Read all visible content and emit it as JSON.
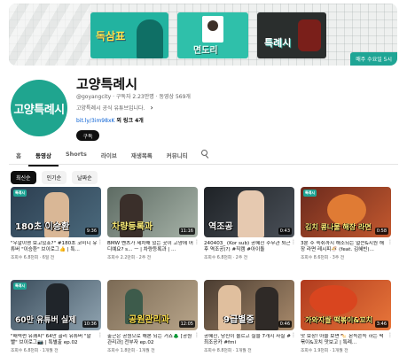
{
  "banner": {
    "card1_text": "독삼표",
    "card2_text": "면도리",
    "card3_text": "특례시",
    "tag": "매주 수요일 5시"
  },
  "channel": {
    "avatar_text": "고양특례시",
    "name": "고양특례시",
    "meta": "@goyangcity · 구독자 2.23만명 · 동영상 569개",
    "description": "고양특례시 공식 유튜브입니다.",
    "link_url": "bit.ly/3im98xK",
    "link_more": "외 링크 4개",
    "subscribe_label": "구독"
  },
  "tabs": [
    {
      "label": "홈"
    },
    {
      "label": "동영상"
    },
    {
      "label": "Shorts"
    },
    {
      "label": "라이브"
    },
    {
      "label": "재생목록"
    },
    {
      "label": "커뮤니티"
    }
  ],
  "chips": [
    {
      "label": "최신순"
    },
    {
      "label": "인기순"
    },
    {
      "label": "날짜순"
    }
  ],
  "videos": [
    {
      "thumb_text": "180초 이승환",
      "duration": "9:36",
      "title": "\"우알이영 보고있죠?\" #180초 코미디 유튜버 \"이승환\" 브이로그👍 | 특...",
      "meta": "조회수 6.8천회 · 6일 전"
    },
    {
      "thumb_text": "차량등록과",
      "duration": "11:16",
      "title": "BMW 벤츠가 세차해 있는 곳이 고양에 어디예요? s... ㅡ | 차량등록과 | ...",
      "meta": "조회수 2.2만회 · 2주 전"
    },
    {
      "thumb_text": "역조공",
      "duration": "0:43",
      "title": "240403_ (Kor sub) 공혜진 주무관 퇴근 후 역조공(?) #직캠 #아이돌",
      "meta": "조회수 6.8천회 · 2주 전"
    },
    {
      "thumb_text": "김치 콩나물 해장 라면",
      "duration": "0:58",
      "title": "3분 주 숙취까지 해소되는 얼큰&시원 해장 라면 레시피🍜 (feat. 김혜빈)...",
      "meta": "조회수 8.6천회 · 3주 전"
    },
    {
      "thumb_text": "60만 유튜버 실제",
      "duration": "10:36",
      "title": "\"매력쩐 유쾌피\" 64만 골리 유튜버 \"말빨\" 브이로그📷 | 특별출 ep.02",
      "meta": "조회수 6.8천회 · 1개월 전"
    },
    {
      "thumb_text": "공원관리과",
      "duration": "12:05",
      "title": "출근은 공원으로 해본 되는 거죠🌲 [공원관리과] 전부자 ep.02",
      "meta": "조회수 1.8만회 · 1개월 전"
    },
    {
      "thumb_text": "9급별중",
      "duration": "0:46",
      "title": "공혜진, 당신이 몰르고 실을 7개지 사실 #최조공카 #fmi",
      "meta": "조회수 8.8천회 · 1개월 전"
    },
    {
      "thumb_text": "가와지쌀 떡볶이&꼬치",
      "duration": "3:46",
      "title": "맛 보장! 아울 보면 🍢 몬득쫀득 하는 떡볶이&꼬치 맛보고 | 특례...",
      "meta": "조회수 1.9천회 · 1개월 전"
    }
  ]
}
